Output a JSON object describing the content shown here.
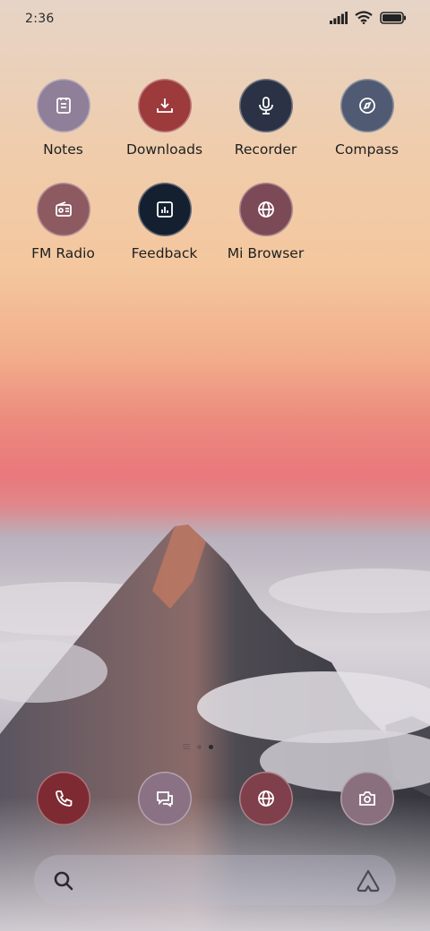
{
  "status_bar": {
    "time": "2:36",
    "icons": [
      "signal-icon",
      "wifi-icon",
      "battery-icon"
    ]
  },
  "apps": [
    {
      "label": "Notes",
      "icon": "notes-icon",
      "color": "#8f7f98"
    },
    {
      "label": "Downloads",
      "icon": "download-icon",
      "color": "#9c3a3c"
    },
    {
      "label": "Recorder",
      "icon": "microphone-icon",
      "color": "#2b3245"
    },
    {
      "label": "Compass",
      "icon": "compass-icon",
      "color": "#505a72"
    },
    {
      "label": "FM Radio",
      "icon": "radio-icon",
      "color": "#8e5a62"
    },
    {
      "label": "Feedback",
      "icon": "chart-icon",
      "color": "#142030"
    },
    {
      "label": "Mi Browser",
      "icon": "globe-icon",
      "color": "#7c4956"
    }
  ],
  "page_indicator": {
    "pages": 2,
    "active": 2
  },
  "dock": [
    {
      "icon": "phone-icon",
      "color": "#7e2a33"
    },
    {
      "icon": "messages-icon",
      "color": "#8a7284"
    },
    {
      "icon": "globe-icon",
      "color": "#7f3f4b"
    },
    {
      "icon": "camera-icon",
      "color": "#8a6f7e"
    }
  ],
  "search": {
    "left_icon": "search-icon",
    "right_icon": "assistant-icon"
  }
}
